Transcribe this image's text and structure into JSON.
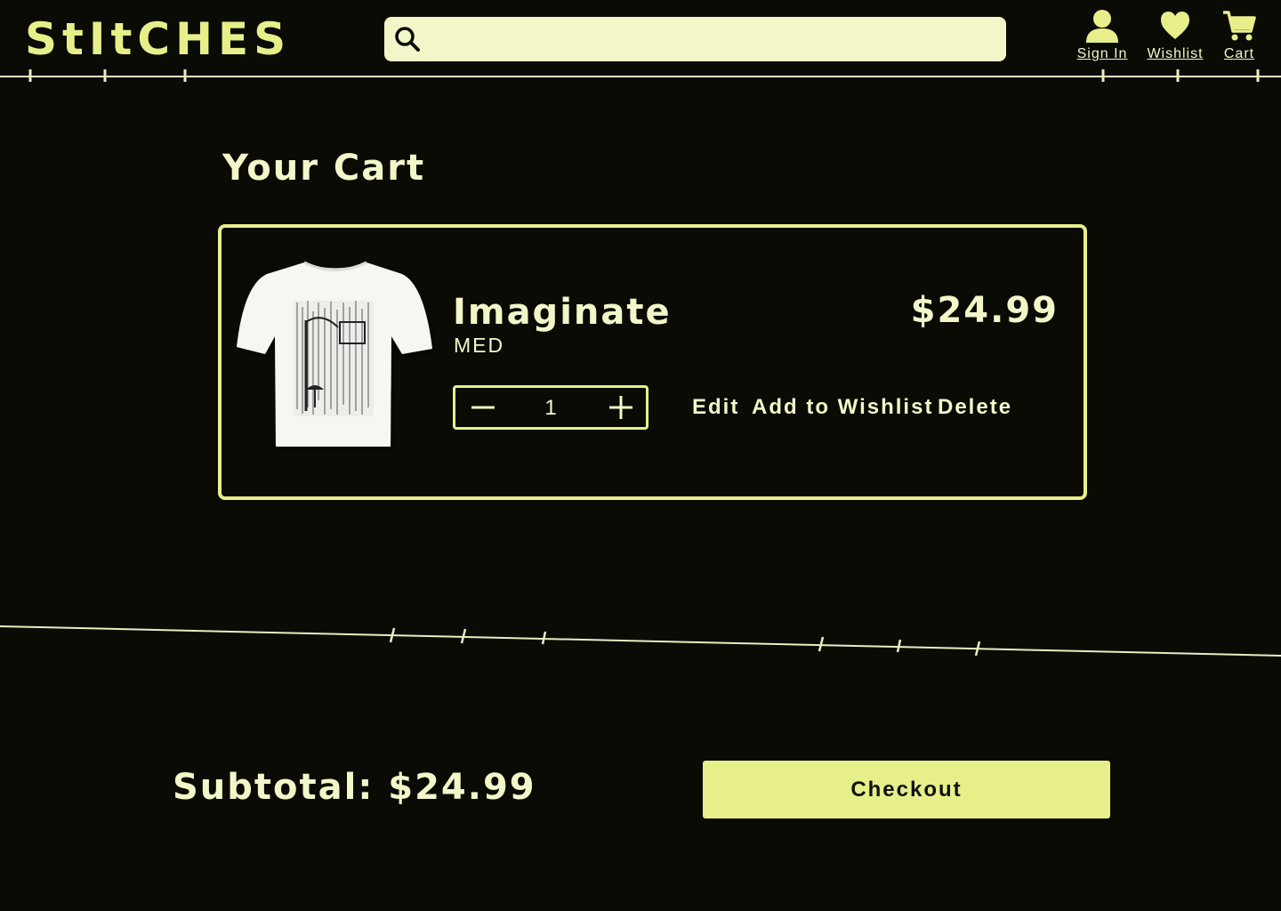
{
  "header": {
    "logo": "StItCHES",
    "search_placeholder": "",
    "nav": {
      "sign_in": "Sign In",
      "wishlist": "Wishlist",
      "cart": "Cart"
    }
  },
  "cart": {
    "title": "Your Cart",
    "item": {
      "name": "Imaginate",
      "size": "MED",
      "price": "$24.99",
      "quantity": "1",
      "actions": {
        "edit": "Edit",
        "add_to_wishlist": "Add to Wishlist",
        "delete": "Delete"
      }
    }
  },
  "summary": {
    "subtotal": "Subtotal: $24.99",
    "checkout": "Checkout"
  },
  "colors": {
    "background": "#0b0b06",
    "accent": "#e7ef8a",
    "text": "#f3f6c8"
  }
}
